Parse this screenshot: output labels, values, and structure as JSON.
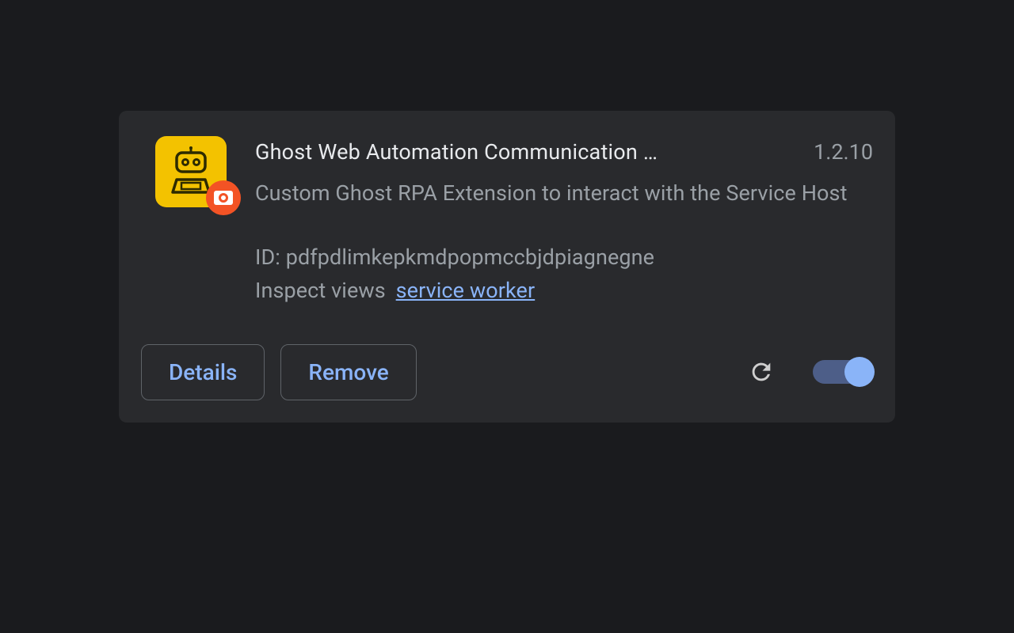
{
  "extension": {
    "name": "Ghost Web Automation Communication …",
    "version": "1.2.10",
    "description": "Custom Ghost RPA Extension to interact with the Service Host",
    "id_label": "ID: ",
    "id": "pdfpdlimkepkmdpopmccbjdpiagnegne",
    "inspect_label": "Inspect views",
    "inspect_link": "service worker"
  },
  "buttons": {
    "details": "Details",
    "remove": "Remove"
  },
  "toggle": {
    "enabled": true
  }
}
